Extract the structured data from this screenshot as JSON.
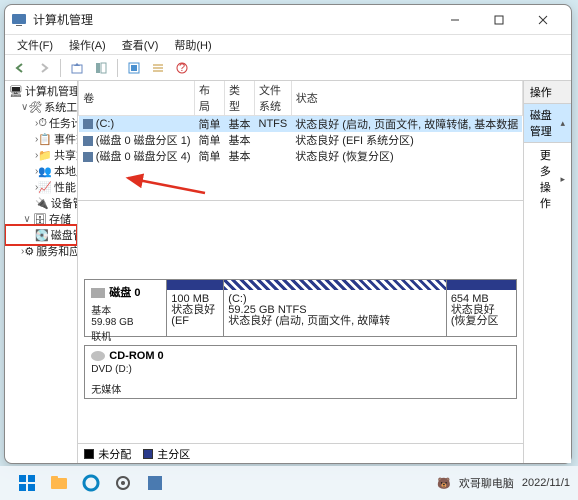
{
  "window": {
    "title": "计算机管理"
  },
  "menu": {
    "file": "文件(F)",
    "action": "操作(A)",
    "view": "查看(V)",
    "help": "帮助(H)"
  },
  "tree": {
    "root": "计算机管理(本地)",
    "system_tools": "系统工具",
    "task_scheduler": "任务计划程序",
    "event_viewer": "事件查看器",
    "shared_folders": "共享文件夹",
    "local_users": "本地用户和组",
    "performance": "性能",
    "device_manager": "设备管理器",
    "storage": "存储",
    "disk_management": "磁盘管理",
    "services_apps": "服务和应用程序"
  },
  "volumes": {
    "headers": {
      "vol": "卷",
      "layout": "布局",
      "type": "类型",
      "fs": "文件系统",
      "status": "状态"
    },
    "rows": [
      {
        "vol": "(C:)",
        "layout": "简单",
        "type": "基本",
        "fs": "NTFS",
        "status": "状态良好 (启动, 页面文件, 故障转储, 基本数据"
      },
      {
        "vol": "(磁盘 0 磁盘分区 1)",
        "layout": "简单",
        "type": "基本",
        "fs": "",
        "status": "状态良好 (EFI 系统分区)"
      },
      {
        "vol": "(磁盘 0 磁盘分区 4)",
        "layout": "简单",
        "type": "基本",
        "fs": "",
        "status": "状态良好 (恢复分区)"
      }
    ]
  },
  "disks": {
    "d0": {
      "name": "磁盘 0",
      "type": "基本",
      "size": "59.98 GB",
      "state": "联机",
      "parts": [
        {
          "label": "",
          "size": "100 MB",
          "status": "状态良好 (EF"
        },
        {
          "label": "(C:)",
          "size": "59.25 GB NTFS",
          "status": "状态良好 (启动, 页面文件, 故障转"
        },
        {
          "label": "",
          "size": "654 MB",
          "status": "状态良好 (恢复分区"
        }
      ]
    },
    "cd": {
      "name": "CD-ROM 0",
      "type": "DVD (D:)",
      "state": "无媒体"
    }
  },
  "legend": {
    "unalloc": "未分配",
    "primary": "主分区"
  },
  "actions": {
    "header": "操作",
    "selected": "磁盘管理",
    "more": "更多操作"
  },
  "tray": {
    "attrib": "欢哥聊电脑",
    "date": "2022/11/1"
  }
}
